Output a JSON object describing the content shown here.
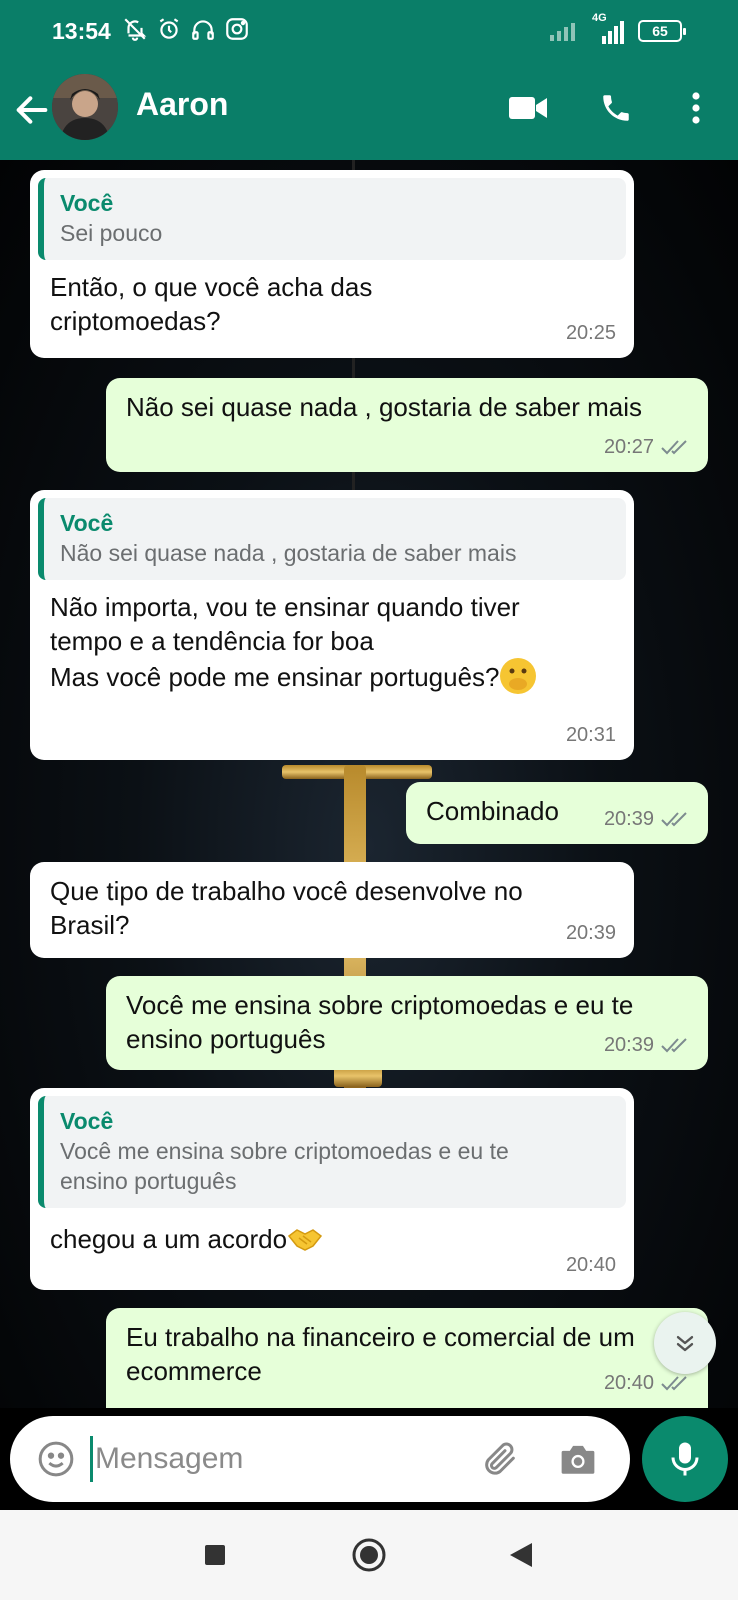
{
  "status_bar": {
    "time": "13:54",
    "network": "4G",
    "battery": "65"
  },
  "header": {
    "contact_name": "Aaron"
  },
  "messages": [
    {
      "direction": "incoming",
      "quote_author": "Você",
      "quote_text": "Sei pouco",
      "text": "Então, o que você acha das criptomoedas?",
      "time": "20:25"
    },
    {
      "direction": "outgoing",
      "text": "Não sei quase nada , gostaria de saber mais",
      "time": "20:27",
      "status": "read"
    },
    {
      "direction": "incoming",
      "quote_author": "Você",
      "quote_text": "Não sei quase nada , gostaria de saber mais",
      "text_line1": "Não importa, vou te ensinar quando tiver tempo e a tendência for boa",
      "text_line2": "Mas você pode me ensinar português?",
      "time": "20:31"
    },
    {
      "direction": "outgoing",
      "text": "Combinado",
      "time": "20:39",
      "status": "read"
    },
    {
      "direction": "incoming",
      "text": "Que tipo de trabalho você desenvolve no Brasil?",
      "time": "20:39"
    },
    {
      "direction": "outgoing",
      "text": "Você me ensina sobre criptomoedas e eu te ensino português",
      "time": "20:39",
      "status": "read"
    },
    {
      "direction": "incoming",
      "quote_author": "Você",
      "quote_text": "Você me ensina sobre criptomoedas e eu te ensino português",
      "text": "chegou a um acordo",
      "time": "20:40"
    },
    {
      "direction": "outgoing",
      "text": "Eu trabalho na financeiro e comercial de um ecommerce",
      "time": "20:40",
      "status": "read"
    }
  ],
  "input": {
    "placeholder": "Mensagem"
  },
  "colors": {
    "header": "#0a7e68",
    "accent": "#0a8a6d",
    "outgoing_bubble": "#e6ffd9",
    "incoming_bubble": "#ffffff",
    "read_ticks": "#7d8b8f"
  }
}
